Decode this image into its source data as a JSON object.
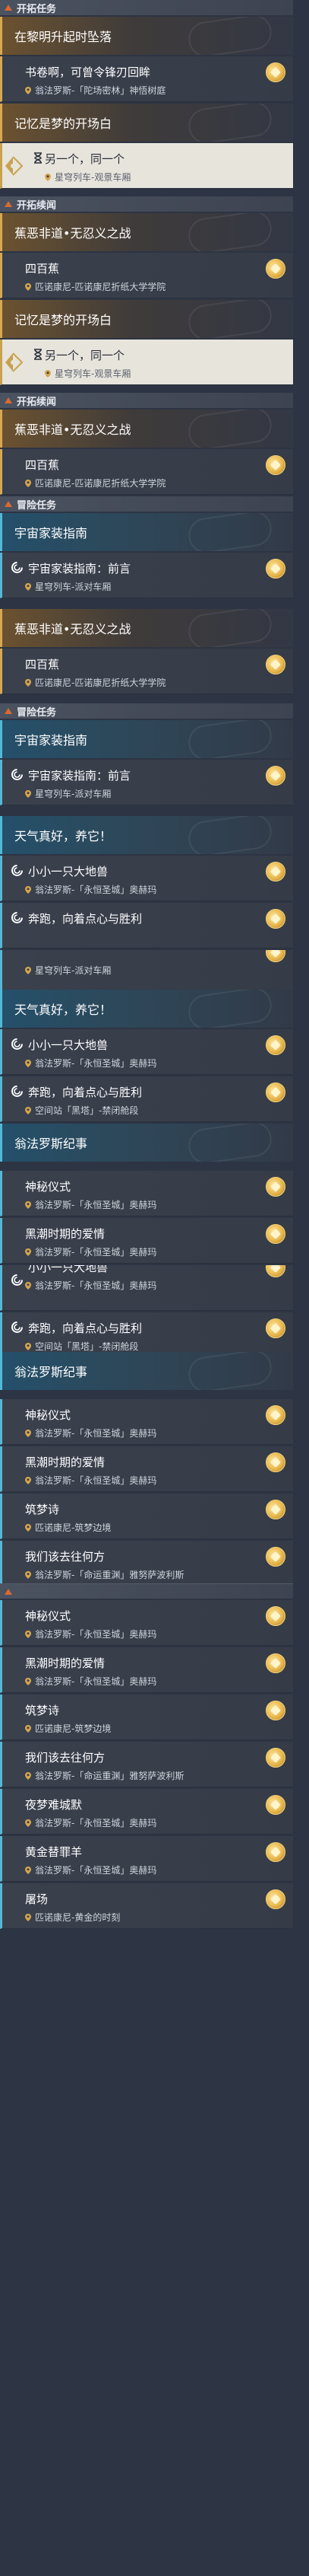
{
  "rows": [
    {
      "kind": "sec",
      "label": "开拓任务"
    },
    {
      "kind": "cat",
      "style": "gold",
      "label": "在黎明升起时坠落"
    },
    {
      "kind": "quest",
      "edge": "gold",
      "title": "书卷啊，可曾令锋刃回眸",
      "loc": "翁法罗斯-「陀场密林」神悟树庭",
      "reward": true
    },
    {
      "kind": "cat",
      "style": "gold",
      "label": "记忆是梦的开场白"
    },
    {
      "kind": "quest",
      "sel": true,
      "icon": "hourglass",
      "title": "另一个，同一个",
      "loc": "星穹列车-观景车厢"
    },
    {
      "kind": "sec",
      "label": "开拓续闻"
    },
    {
      "kind": "cat",
      "style": "gold",
      "label": "蕉恶非道•无忍义之战"
    },
    {
      "kind": "quest",
      "edge": "gold",
      "title": "四百蕉",
      "loc": "匹诺康尼-匹诺康尼折纸大学学院",
      "reward": true
    },
    {
      "kind": "cat",
      "style": "gold",
      "label": "记忆是梦的开场白"
    },
    {
      "kind": "quest",
      "sel": true,
      "icon": "hourglass",
      "title": "另一个，同一个",
      "loc": "星穹列车-观景车厢"
    },
    {
      "kind": "sec",
      "label": "开拓续闻"
    },
    {
      "kind": "cat",
      "style": "gold",
      "label": "蕉恶非道•无忍义之战"
    },
    {
      "kind": "quest",
      "edge": "gold",
      "title": "四百蕉",
      "loc": "匹诺康尼-匹诺康尼折纸大学学院",
      "reward": true
    },
    {
      "kind": "sec",
      "label": "冒险任务"
    },
    {
      "kind": "cat",
      "style": "blue",
      "label": "宇宙家装指南"
    },
    {
      "kind": "quest",
      "edge": "blue",
      "icon": "swirl",
      "title": "宇宙家装指南：前言",
      "loc": "星穹列车-派对车厢",
      "reward": true
    },
    {
      "kind": "cat",
      "style": "gold",
      "label": "蕉恶非道•无忍义之战"
    },
    {
      "kind": "quest",
      "edge": "gold",
      "title": "四百蕉",
      "loc": "匹诺康尼-匹诺康尼折纸大学学院",
      "reward": true
    },
    {
      "kind": "sec",
      "label": "冒险任务"
    },
    {
      "kind": "cat",
      "style": "blue",
      "label": "宇宙家装指南"
    },
    {
      "kind": "quest",
      "edge": "blue",
      "icon": "swirl",
      "title": "宇宙家装指南：前言",
      "loc": "星穹列车-派对车厢",
      "reward": true
    },
    {
      "kind": "cat",
      "style": "blue",
      "label": "天气真好，养它！"
    },
    {
      "kind": "quest",
      "edge": "blue",
      "icon": "swirl",
      "title": "小小一只大地兽",
      "loc": "翁法罗斯-「永恒圣城」奥赫玛",
      "reward": true
    },
    {
      "kind": "quest",
      "edge": "blue",
      "icon": "swirl",
      "title": "奔跑，向着点心与胜利",
      "loc": "",
      "reward": true,
      "short": true
    },
    {
      "kind": "quest",
      "edge": "blue",
      "title": "",
      "loc": "星穹列车-派对车厢",
      "reward": true,
      "cut": true
    },
    {
      "kind": "cat",
      "style": "blue",
      "label": "天气真好，养它！"
    },
    {
      "kind": "quest",
      "edge": "blue",
      "icon": "swirl",
      "title": "小小一只大地兽",
      "loc": "翁法罗斯-「永恒圣城」奥赫玛",
      "reward": true
    },
    {
      "kind": "quest",
      "edge": "blue",
      "icon": "swirl",
      "title": "奔跑，向着点心与胜利",
      "loc": "空间站「黑塔」-禁闭舱段",
      "reward": true
    },
    {
      "kind": "cat",
      "style": "blue",
      "label": "翁法罗斯纪事"
    },
    {
      "kind": "quest",
      "edge": "blue",
      "title": "神秘仪式",
      "loc": "翁法罗斯-「永恒圣城」奥赫玛",
      "reward": true
    },
    {
      "kind": "quest",
      "edge": "blue",
      "title": "黑潮时期的爱情",
      "loc": "翁法罗斯-「永恒圣城」奥赫玛",
      "reward": true
    },
    {
      "kind": "quest",
      "edge": "blue",
      "icon": "swirl",
      "title": "小小一只大地兽",
      "loc": "翁法罗斯-「永恒圣城」奥赫玛",
      "reward": true,
      "cut": true
    },
    {
      "kind": "quest",
      "edge": "blue",
      "icon": "swirl",
      "title": "奔跑，向着点心与胜利",
      "loc": "空间站「黑塔」-禁闭舱段",
      "reward": true
    },
    {
      "kind": "cat",
      "style": "blue",
      "label": "翁法罗斯纪事"
    },
    {
      "kind": "quest",
      "edge": "blue",
      "title": "神秘仪式",
      "loc": "翁法罗斯-「永恒圣城」奥赫玛",
      "reward": true
    },
    {
      "kind": "quest",
      "edge": "blue",
      "title": "黑潮时期的爱情",
      "loc": "翁法罗斯-「永恒圣城」奥赫玛",
      "reward": true
    },
    {
      "kind": "quest",
      "edge": "blue",
      "title": "筑梦诗",
      "loc": "匹诺康尼-筑梦边境",
      "reward": true
    },
    {
      "kind": "quest",
      "edge": "blue",
      "title": "我们该去往何方",
      "loc": "翁法罗斯-「命运重渊」雅努萨波利斯",
      "reward": true
    },
    {
      "kind": "sec",
      "label": "",
      "trailing": true
    },
    {
      "kind": "quest",
      "edge": "blue",
      "title": "神秘仪式",
      "loc": "翁法罗斯-「永恒圣城」奥赫玛",
      "reward": true
    },
    {
      "kind": "quest",
      "edge": "blue",
      "title": "黑潮时期的爱情",
      "loc": "翁法罗斯-「永恒圣城」奥赫玛",
      "reward": true
    },
    {
      "kind": "quest",
      "edge": "blue",
      "title": "筑梦诗",
      "loc": "匹诺康尼-筑梦边境",
      "reward": true
    },
    {
      "kind": "quest",
      "edge": "blue",
      "title": "我们该去往何方",
      "loc": "翁法罗斯-「命运重渊」雅努萨波利斯",
      "reward": true
    },
    {
      "kind": "quest",
      "edge": "blue",
      "title": "夜梦难城默",
      "loc": "翁法罗斯-「永恒圣城」奥赫玛",
      "reward": true
    },
    {
      "kind": "quest",
      "edge": "blue",
      "title": "黄金替罪羊",
      "loc": "翁法罗斯-「永恒圣城」奥赫玛",
      "reward": true
    },
    {
      "kind": "quest",
      "edge": "blue",
      "title": "屠场",
      "loc": "匹诺康尼-黄金的时刻",
      "reward": true
    }
  ],
  "colors": {
    "gold_accent": "#d7a751",
    "blue_accent": "#55b7d6",
    "section_marker": "#d86a32",
    "selected_bg": "#e7e4dc"
  }
}
